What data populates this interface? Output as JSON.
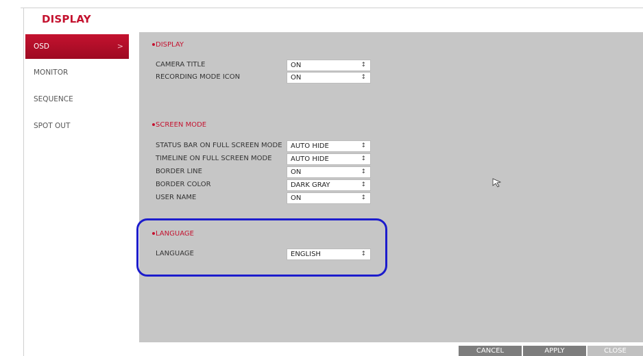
{
  "page_title": "DISPLAY",
  "sidebar": {
    "items": [
      {
        "label": "OSD",
        "active": true
      },
      {
        "label": "MONITOR",
        "active": false
      },
      {
        "label": "SEQUENCE",
        "active": false
      },
      {
        "label": "SPOT OUT",
        "active": false
      }
    ],
    "active_chevron": ">"
  },
  "sections": {
    "display": {
      "title": "DISPLAY",
      "rows": [
        {
          "label": "CAMERA TITLE",
          "value": "ON"
        },
        {
          "label": "RECORDING MODE ICON",
          "value": "ON"
        }
      ]
    },
    "screen_mode": {
      "title": "SCREEN MODE",
      "rows": [
        {
          "label": "STATUS BAR ON FULL SCREEN MODE",
          "value": "AUTO HIDE"
        },
        {
          "label": "TIMELINE ON FULL SCREEN MODE",
          "value": "AUTO HIDE"
        },
        {
          "label": "BORDER LINE",
          "value": "ON"
        },
        {
          "label": "BORDER COLOR",
          "value": "DARK GRAY"
        },
        {
          "label": "USER NAME",
          "value": "ON"
        }
      ]
    },
    "language": {
      "title": "LANGUAGE",
      "rows": [
        {
          "label": "LANGUAGE",
          "value": "ENGLISH"
        }
      ]
    }
  },
  "select_arrow_icon": "updown-arrows-icon",
  "footer": {
    "cancel": "CANCEL",
    "apply": "APPLY",
    "close": "CLOSE"
  },
  "colors": {
    "accent": "#c4122f",
    "panel": "#c6c6c6",
    "highlight": "#1c1ccc",
    "button": "#7d7d7d"
  }
}
